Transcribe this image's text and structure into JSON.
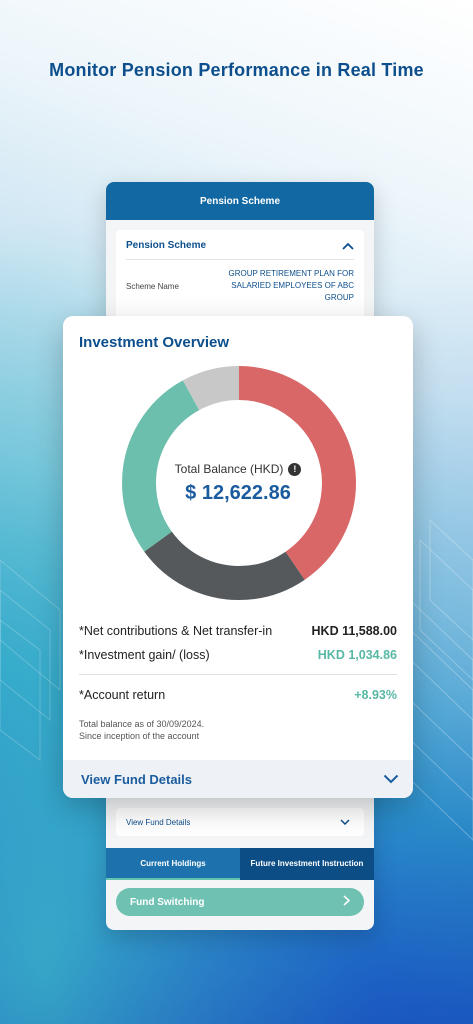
{
  "hero": {
    "title": "Monitor Pension Performance in Real Time"
  },
  "back_screen": {
    "header_title": "Pension Scheme",
    "scheme_panel": {
      "title": "Pension Scheme",
      "scheme_name_label": "Scheme Name",
      "scheme_name_value": "GROUP RETIREMENT PLAN FOR SALARIED EMPLOYEES OF ABC GROUP"
    },
    "view_fund_details": "View Fund Details",
    "tabs": [
      {
        "label": "Current Holdings",
        "selected": true
      },
      {
        "label": "Future Investment Instruction",
        "selected": false
      }
    ],
    "fund_switching": "Fund Switching"
  },
  "overview": {
    "title": "Investment Overview",
    "total_balance_label": "Total Balance (HKD)",
    "total_balance_value": "$ 12,622.86",
    "rows": [
      {
        "label": "*Net contributions & Net transfer-in",
        "value": "HKD 11,588.00"
      },
      {
        "label": "*Investment gain/ (loss)",
        "value": "HKD 1,034.86"
      },
      {
        "label": "*Account return",
        "value": "+8.93%"
      }
    ],
    "as_of_line1": "Total balance as of 30/09/2024.",
    "as_of_line2": "Since inception of the account",
    "view_fund_details": "View Fund Details"
  },
  "donut": {
    "segments": [
      {
        "name": "red",
        "color": "#d96767",
        "fraction": 0.405
      },
      {
        "name": "dark",
        "color": "#55595c",
        "fraction": 0.245
      },
      {
        "name": "teal",
        "color": "#6cbfad",
        "fraction": 0.27
      },
      {
        "name": "grey",
        "color": "#c8c8c8",
        "fraction": 0.08
      }
    ]
  },
  "colors": {
    "brand_blue": "#0d4f8c",
    "header_blue": "#1268a3",
    "positive_green": "#58b8a6"
  }
}
